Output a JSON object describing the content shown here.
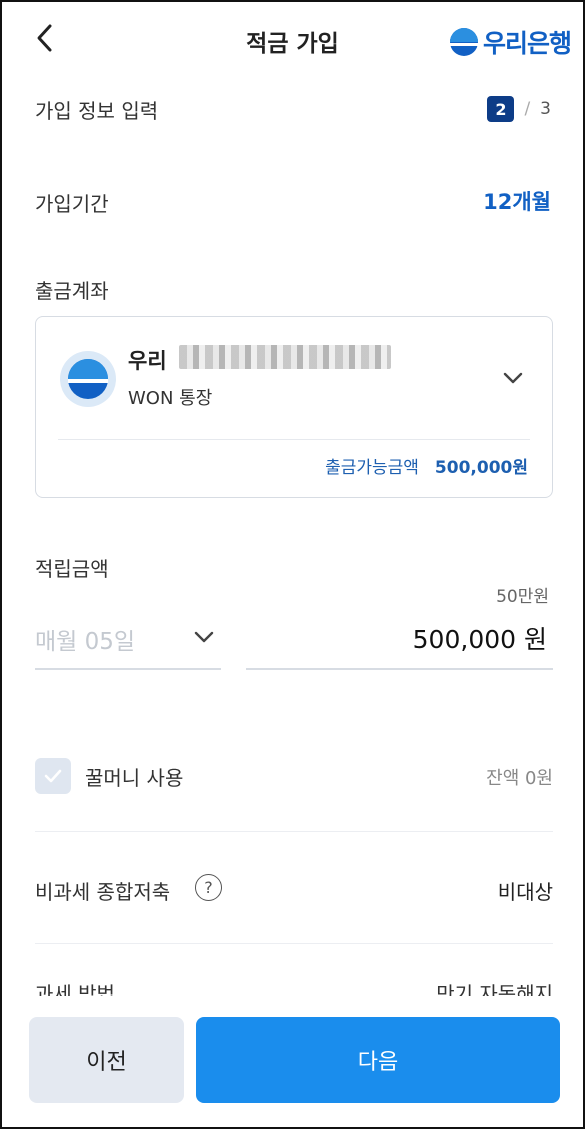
{
  "header": {
    "title": "적금 가입",
    "brand_name": "우리은행",
    "brand_color": "#1160c4"
  },
  "section": {
    "title": "가입 정보 입력",
    "step_current": "2",
    "step_separator": "/",
    "step_total": "3"
  },
  "period": {
    "label": "가입기간",
    "value": "12개월"
  },
  "account": {
    "label": "출금계좌",
    "bank": "우리",
    "type": "WON 통장",
    "available_label": "출금가능금액",
    "available_value": "500,000원"
  },
  "deposit": {
    "label": "적립금액",
    "unit_hint": "50만원",
    "day_value": "매월 05일",
    "amount_value": "500,000 원"
  },
  "honey_money": {
    "label": "꿀머니 사용",
    "balance": "잔액 0원"
  },
  "tax_free": {
    "label": "비과세 종합저축",
    "help": "?",
    "value": "비대상"
  },
  "partial_row": {
    "left": "과세 방법",
    "right": "만기 자동해지"
  },
  "buttons": {
    "prev": "이전",
    "next": "다음"
  },
  "colors": {
    "accent": "#1160c4",
    "primary_button": "#1a8ded",
    "step_badge": "#0d3c87"
  }
}
